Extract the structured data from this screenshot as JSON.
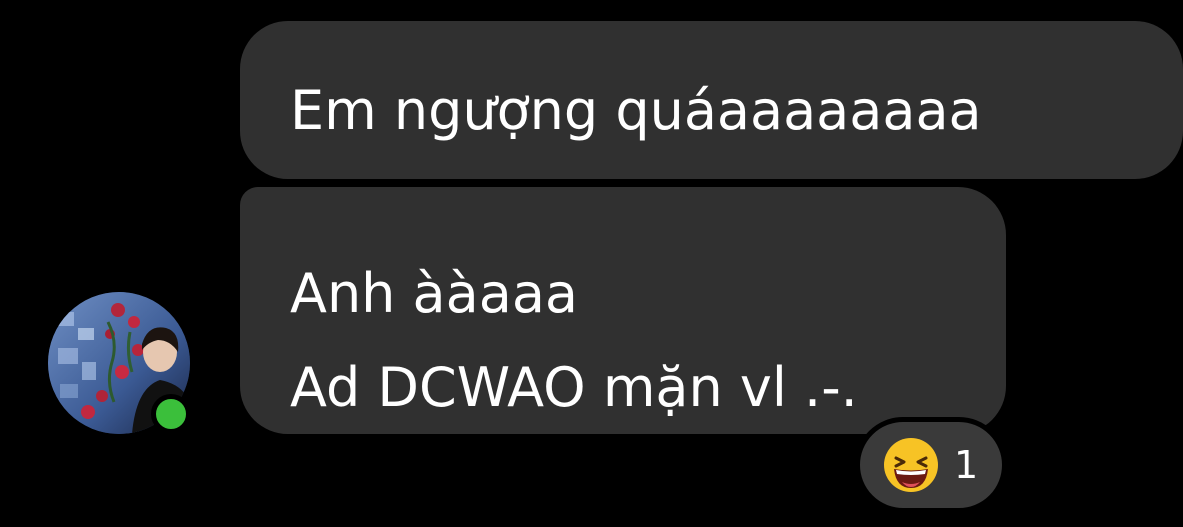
{
  "messages": [
    {
      "lines": [
        "Em ngượng quáaaaaaaaa"
      ]
    },
    {
      "lines": [
        "Anh ààaaa",
        "Ad DCWAO mặn vl .-."
      ]
    }
  ],
  "reaction": {
    "emoji": "laughing-face-icon",
    "count": "1"
  },
  "avatar": {
    "online": true
  },
  "colors": {
    "background": "#000000",
    "bubble": "#303030",
    "online": "#3bbf3b",
    "reaction_pill": "#3a3a3a"
  }
}
